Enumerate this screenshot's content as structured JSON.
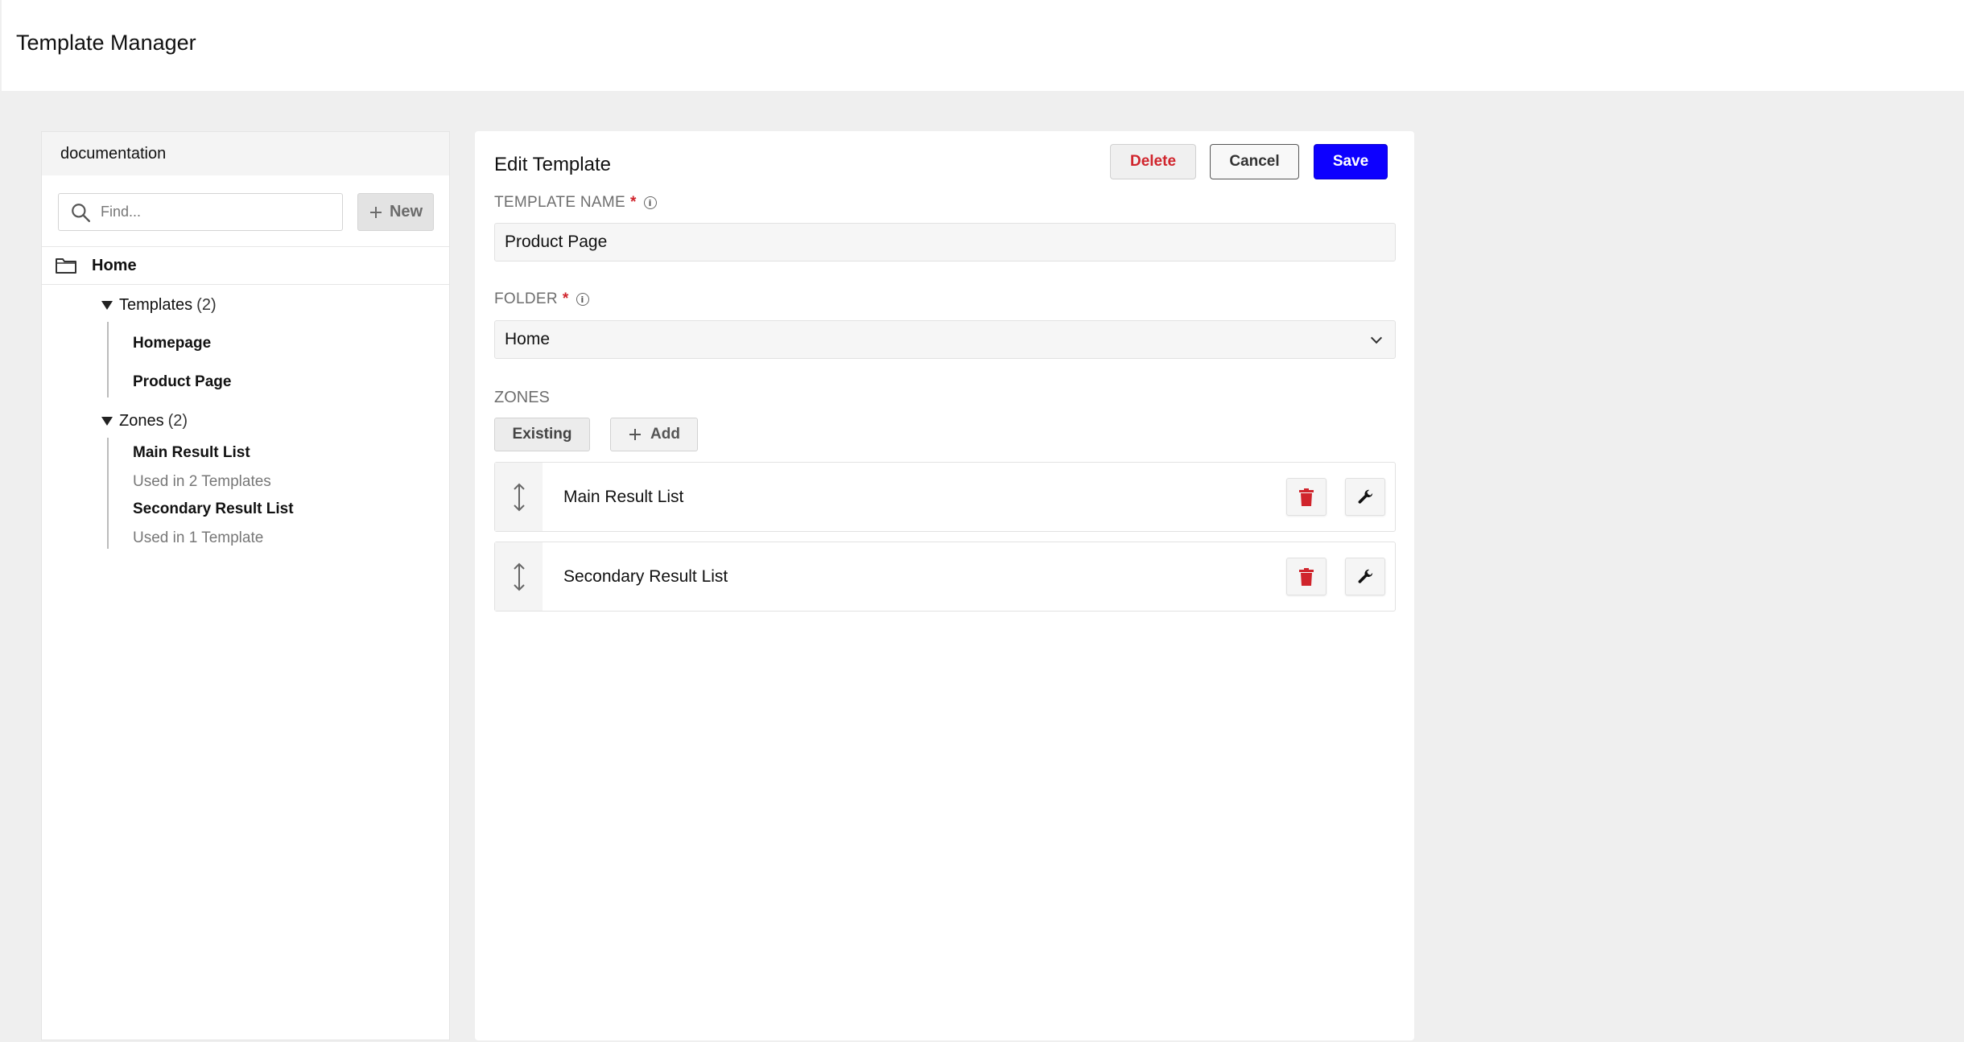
{
  "app": {
    "title": "Template Manager"
  },
  "sidebar": {
    "workspace": "documentation",
    "search_placeholder": "Find...",
    "new_label": "New",
    "root": {
      "label": "Home"
    },
    "templates_group": {
      "label": "Templates",
      "count": "(2)"
    },
    "templates": [
      {
        "label": "Homepage"
      },
      {
        "label": "Product Page"
      }
    ],
    "zones_group": {
      "label": "Zones",
      "count": "(2)"
    },
    "zones": [
      {
        "label": "Main Result List",
        "usage": "Used in 2 Templates"
      },
      {
        "label": "Secondary Result List",
        "usage": "Used in 1 Template"
      }
    ]
  },
  "editor": {
    "title": "Edit Template",
    "delete_label": "Delete",
    "cancel_label": "Cancel",
    "save_label": "Save",
    "template_name_label": "TEMPLATE NAME",
    "template_name_value": "Product Page",
    "folder_label": "FOLDER",
    "folder_value": "Home",
    "required_mark": "*",
    "info_glyph": "i",
    "zones_label": "ZONES",
    "existing_label": "Existing",
    "add_label": "Add",
    "zones": [
      {
        "name": "Main Result List"
      },
      {
        "name": "Secondary Result List"
      }
    ]
  },
  "colors": {
    "primary": "#0d00ff",
    "danger": "#d0242c",
    "background": "#efefef"
  },
  "icons": [
    "search-icon",
    "plus-icon",
    "folder-icon",
    "caret-down-icon",
    "info-icon",
    "chevron-down-icon",
    "drag-handle-icon",
    "trash-icon",
    "wrench-icon"
  ]
}
